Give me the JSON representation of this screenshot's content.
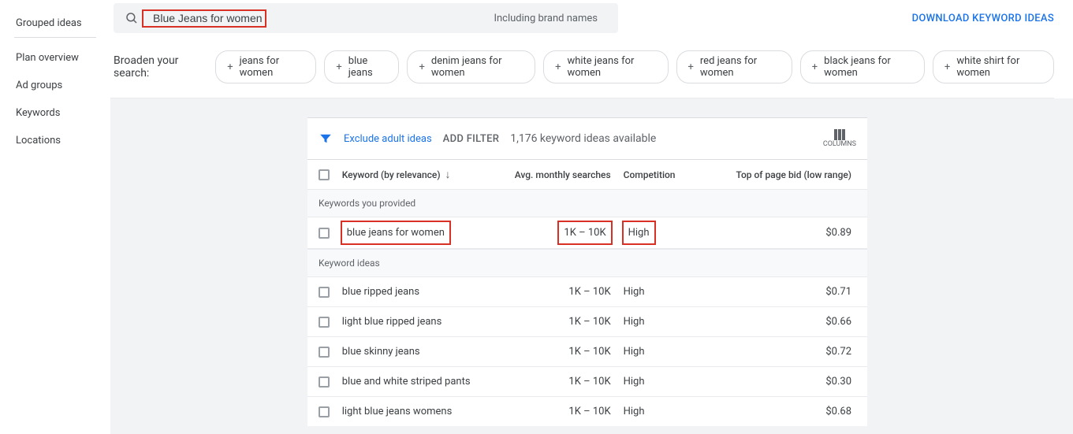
{
  "sidebar": {
    "items": [
      {
        "label": "Grouped ideas",
        "active": true
      },
      {
        "label": "Plan overview"
      },
      {
        "label": "Ad groups"
      },
      {
        "label": "Keywords"
      },
      {
        "label": "Locations"
      }
    ]
  },
  "search": {
    "value": "Blue Jeans for women",
    "including_label": "Including brand names"
  },
  "download_label": "DOWNLOAD KEYWORD IDEAS",
  "broaden": {
    "label": "Broaden your search:",
    "chips": [
      "jeans for women",
      "blue jeans",
      "denim jeans for women",
      "white jeans for women",
      "red jeans for women",
      "black jeans for women",
      "white shirt for women"
    ]
  },
  "filter_bar": {
    "exclude_label": "Exclude adult ideas",
    "add_filter_label": "ADD FILTER",
    "ideas_available": "1,176 keyword ideas available",
    "columns_label": "COLUMNS"
  },
  "columns": {
    "keyword": "Keyword (by relevance)",
    "avg": "Avg. monthly searches",
    "competition": "Competition",
    "bid": "Top of page bid (low range)"
  },
  "sections": {
    "provided": "Keywords you provided",
    "ideas": "Keyword ideas"
  },
  "provided_rows": [
    {
      "keyword": "blue jeans for women",
      "avg": "1K – 10K",
      "competition": "High",
      "bid": "$0.89"
    }
  ],
  "idea_rows": [
    {
      "keyword": "blue ripped jeans",
      "avg": "1K – 10K",
      "competition": "High",
      "bid": "$0.71"
    },
    {
      "keyword": "light blue ripped jeans",
      "avg": "1K – 10K",
      "competition": "High",
      "bid": "$0.66"
    },
    {
      "keyword": "blue skinny jeans",
      "avg": "1K – 10K",
      "competition": "High",
      "bid": "$0.72"
    },
    {
      "keyword": "blue and white striped pants",
      "avg": "1K – 10K",
      "competition": "High",
      "bid": "$0.30"
    },
    {
      "keyword": "light blue jeans womens",
      "avg": "1K – 10K",
      "competition": "High",
      "bid": "$0.68"
    }
  ]
}
